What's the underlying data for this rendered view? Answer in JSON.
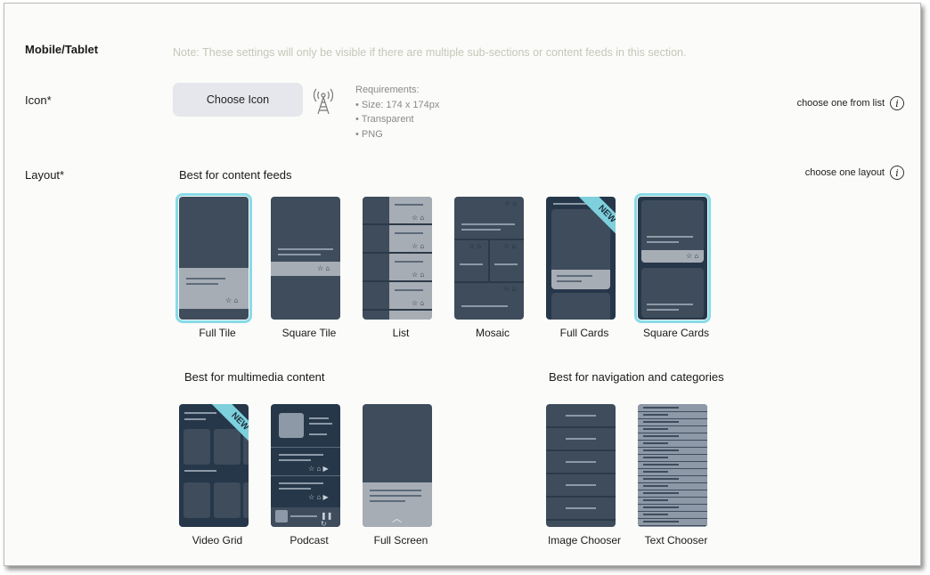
{
  "section": {
    "title": "Mobile/Tablet",
    "note": "Note: These settings will only be visible if there are multiple sub-sections or content feeds in this section."
  },
  "icon_row": {
    "label": "Icon*",
    "button_label": "Choose Icon",
    "current_icon": "broadcast-tower-icon",
    "requirements_title": "Requirements:",
    "requirements": [
      "• Size: 174 x 174px",
      "• Transparent",
      "• PNG"
    ],
    "hint": "choose one from list"
  },
  "layout_row": {
    "label": "Layout*",
    "hint": "choose one layout",
    "groups": {
      "content_feeds": "Best for content feeds",
      "multimedia": "Best for multimedia content",
      "navigation": "Best for navigation and categories"
    },
    "layouts": {
      "full_tile": "Full Tile",
      "square_tile": "Square Tile",
      "list": "List",
      "mosaic": "Mosaic",
      "full_cards": "Full Cards",
      "square_cards": "Square Cards",
      "video_grid": "Video Grid",
      "podcast": "Podcast",
      "full_screen": "Full Screen",
      "image_chooser": "Image Chooser",
      "text_chooser": "Text Chooser"
    },
    "new_badge": "NEW",
    "selected": [
      "Full Tile",
      "Square Cards"
    ]
  },
  "colors": {
    "selected_outline": "#88dbe7",
    "tile_bg": "#3e4c5c",
    "new_ribbon": "#7dd0dc",
    "button_bg": "#e5e7ec"
  }
}
